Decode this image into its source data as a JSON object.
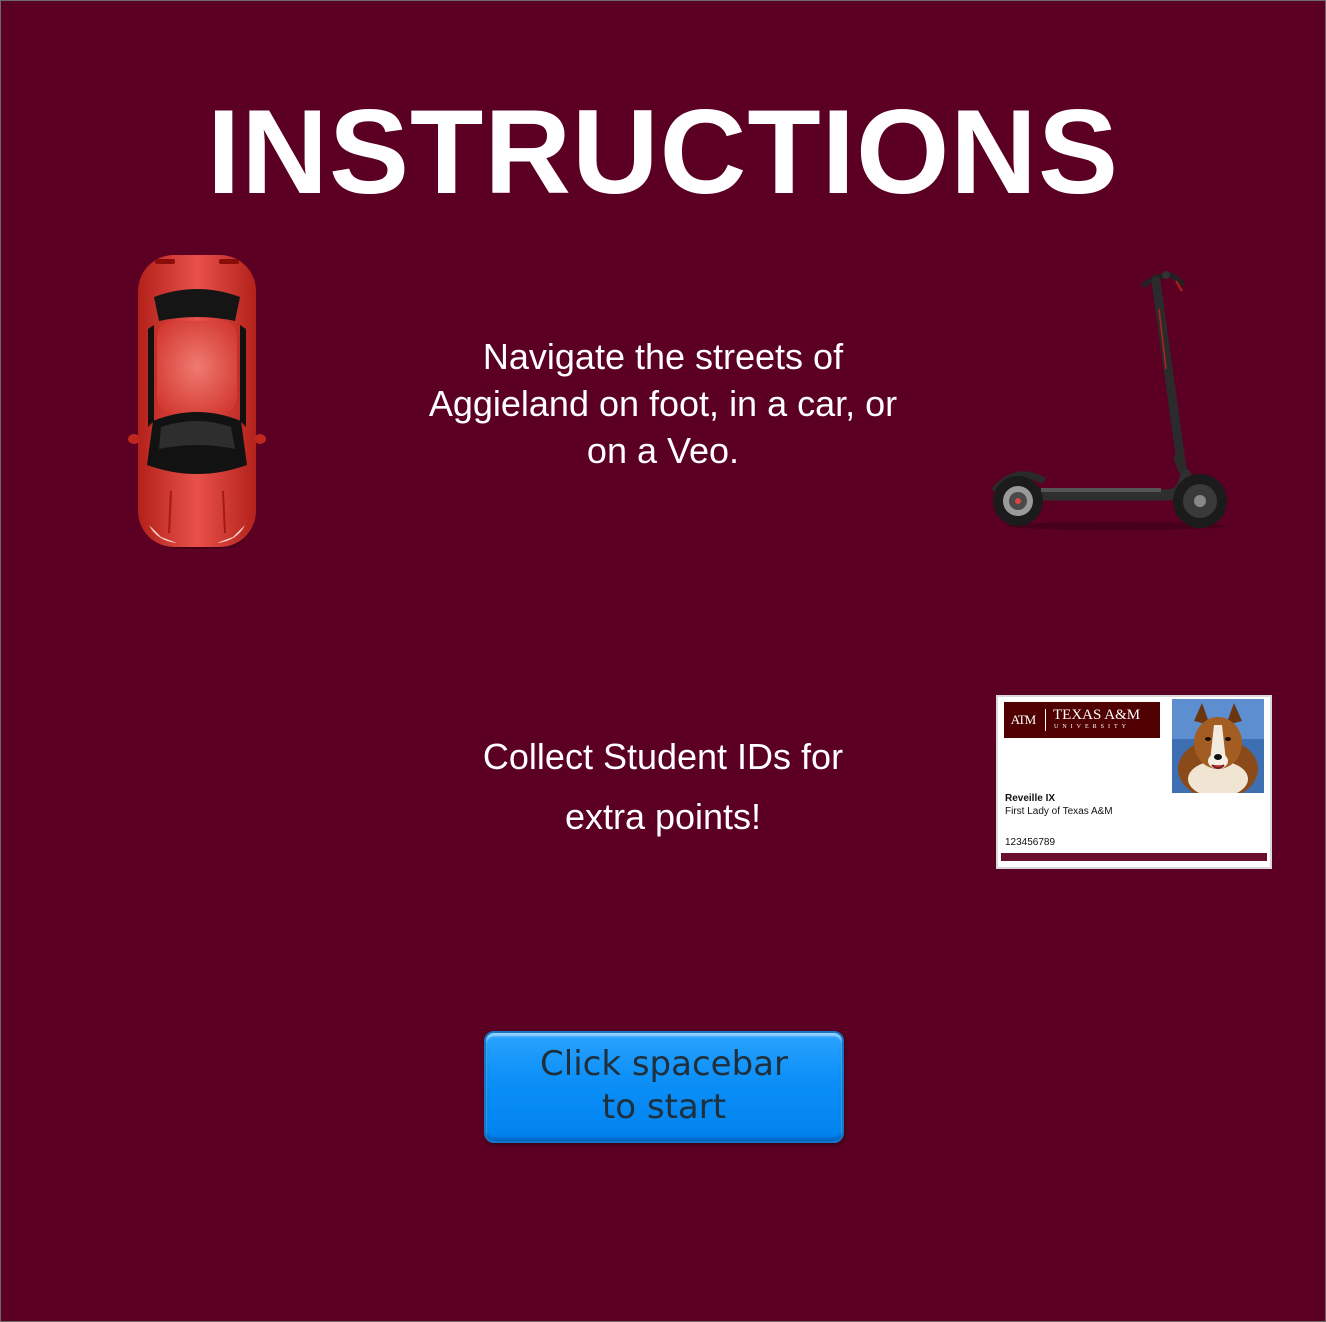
{
  "screen": {
    "title": "INSTRUCTIONS",
    "background_color": "#5b0022"
  },
  "instructions": {
    "navigate_lines": [
      "Navigate the streets of",
      "Aggieland on foot, in a car, or",
      "on a Veo."
    ],
    "collect_lines": [
      "Collect Student IDs for",
      "extra points!"
    ]
  },
  "sprites": {
    "car": "red-car-icon",
    "scooter": "electric-scooter-icon"
  },
  "student_id": {
    "logo": "ATM",
    "university": "TEXAS A&M",
    "university_sub": "UNIVERSITY",
    "name": "Reveille IX",
    "title": "First Lady of Texas A&M",
    "number": "123456789",
    "photo": "collie-dog-photo",
    "accent_color": "#500000"
  },
  "start_button": {
    "lines": [
      "Click spacebar",
      "to start"
    ],
    "color": "#0b8ff7"
  }
}
